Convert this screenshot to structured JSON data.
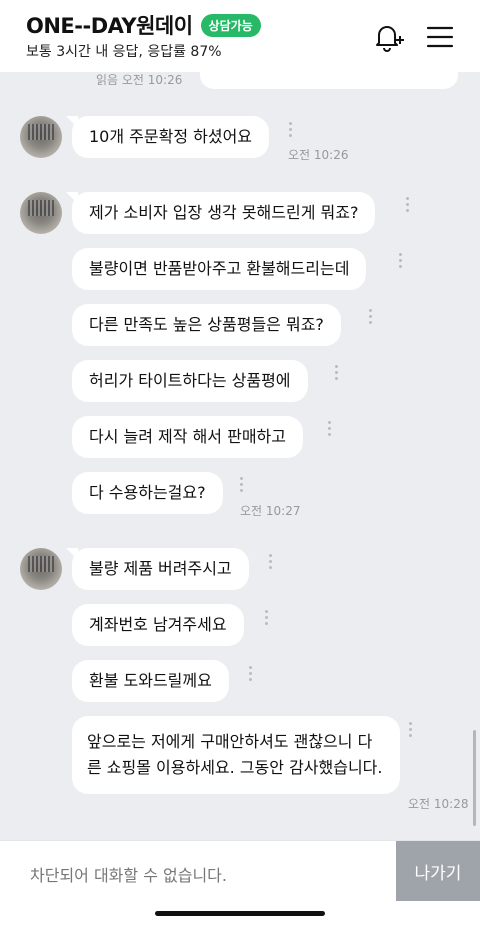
{
  "header": {
    "shop_name": "ONE--DAY원데이",
    "badge": "상담가능",
    "subtitle": "보통 3시간 내 응답, 응답률 87%",
    "bell_icon": "bell-plus-icon",
    "menu_icon": "hamburger-menu-icon"
  },
  "chat": {
    "read_receipt": "읽음 오전 10:26",
    "groups": [
      {
        "messages": [
          "10개 주문확정 하셨어요"
        ],
        "time": "오전 10:26"
      },
      {
        "messages": [
          "제가 소비자 입장 생각 못해드린게 뭐죠?",
          "불량이면 반품받아주고 환불해드리는데",
          "다른 만족도 높은 상품평들은 뭐죠?",
          "허리가 타이트하다는 상품평에",
          "다시 늘려 제작 해서 판매하고",
          "다 수용하는걸요?"
        ],
        "time": "오전 10:27"
      },
      {
        "messages": [
          "불량 제품 버려주시고",
          "계좌번호 남겨주세요",
          "환불 도와드릴께요",
          "앞으로는 저에게 구매안하셔도 괜찮으니 다른 쇼핑몰 이용하세요. 그동안 감사했습니다."
        ],
        "time": "오전 10:28"
      }
    ]
  },
  "footer": {
    "blocked_text": "차단되어 대화할 수 없습니다.",
    "exit_label": "나가기"
  },
  "colors": {
    "badge_green": "#27b968",
    "chat_bg": "#ebedf1",
    "exit_gray": "#9fa3aa"
  }
}
